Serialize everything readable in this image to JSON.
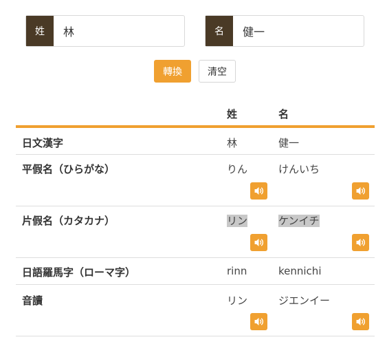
{
  "form": {
    "last_name_label": "姓",
    "last_name_value": "林",
    "first_name_label": "名",
    "first_name_value": "健一",
    "convert_label": "轉換",
    "clear_label": "清空"
  },
  "table": {
    "headers": {
      "last": "姓",
      "first": "名"
    },
    "rows": [
      {
        "label": "日文漢字",
        "last": "林",
        "first": "健一"
      },
      {
        "label": "平假名（ひらがな）",
        "last": "りん",
        "first": "けんいち"
      },
      {
        "label": "片假名（カタカナ）",
        "last": "リン",
        "first": "ケンイチ"
      },
      {
        "label": "日語羅馬字（ローマ字）",
        "last": "rinn",
        "first": "kennichi"
      },
      {
        "label": "音讀",
        "last": "リン",
        "first": "ジエンイー"
      }
    ]
  },
  "colors": {
    "accent": "#f0a030",
    "label_bg": "#4a3a26",
    "highlight": "#c8c8c8"
  },
  "icons": {
    "audio": "speaker-icon"
  }
}
